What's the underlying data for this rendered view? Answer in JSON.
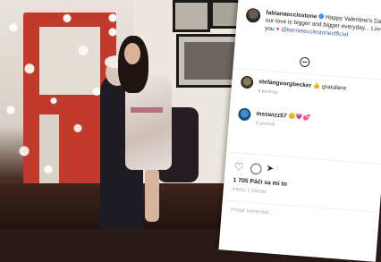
{
  "post": {
    "username": "fabianaecclestone",
    "caption_part1": "Happy Valentine's Day",
    "caption_part2": "our love is bigger and bigger everyday... Love you",
    "mention": "@bernieecclestoneofficial",
    "heart_glyph": "♥"
  },
  "comments": [
    {
      "username": "stefangeorgbecker",
      "text": "👍 gratuliere",
      "emoji_after": "",
      "time": "4 povezat"
    },
    {
      "username": "msswizz57",
      "text": "😊💗💕",
      "emoji_after": "",
      "time": "4 povezat"
    }
  ],
  "likes_text": "1 705 Páči sa mi to",
  "date_text": "PRED 1 DŇOM",
  "add_comment_placeholder": "Pridať komentár...",
  "icons": {
    "like": "♡",
    "comment": "◯",
    "share": "➤"
  },
  "colors": {
    "verified": "#3897f0",
    "heart": "#ed4956",
    "mention": "#3a5e8c"
  }
}
